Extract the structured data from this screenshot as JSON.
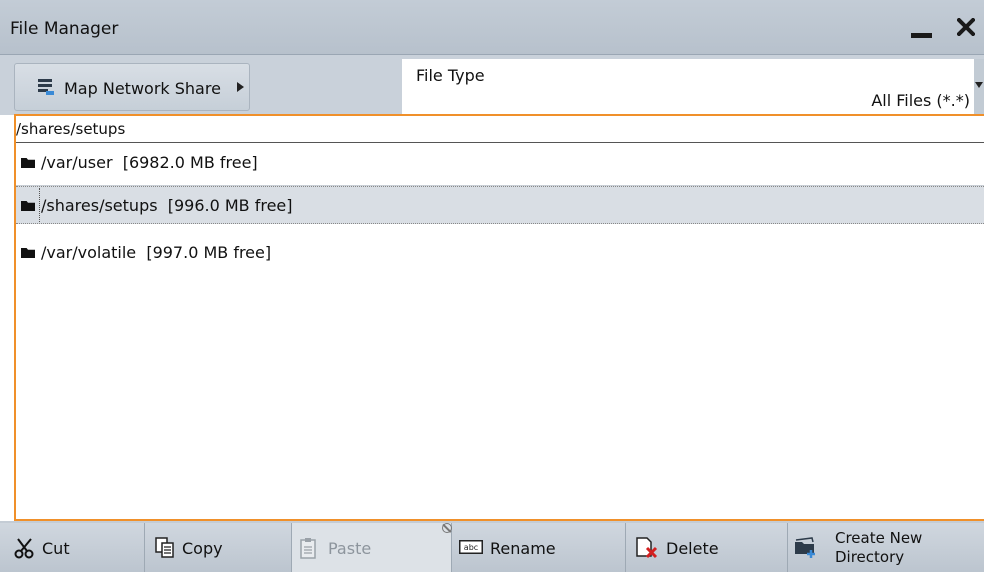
{
  "window": {
    "title": "File Manager"
  },
  "toolbar": {
    "map_network_share": "Map Network Share",
    "file_type_label": "File Type",
    "file_type_value": "All Files (*.*)"
  },
  "current_path": "/shares/setups",
  "volumes": [
    {
      "label": "/var/user  [6982.0 MB free]",
      "selected": false
    },
    {
      "label": "/shares/setups  [996.0 MB free]",
      "selected": true
    },
    {
      "label": "/var/volatile  [997.0 MB free]",
      "selected": false
    }
  ],
  "actions": {
    "cut": "Cut",
    "copy": "Copy",
    "paste": "Paste",
    "rename": "Rename",
    "delete": "Delete",
    "create_new_directory_line1": "Create New",
    "create_new_directory_line2": "Directory"
  },
  "colors": {
    "focus_border": "#f0902a",
    "selected_row": "#d9dee4",
    "delete_mark": "#d32020"
  }
}
